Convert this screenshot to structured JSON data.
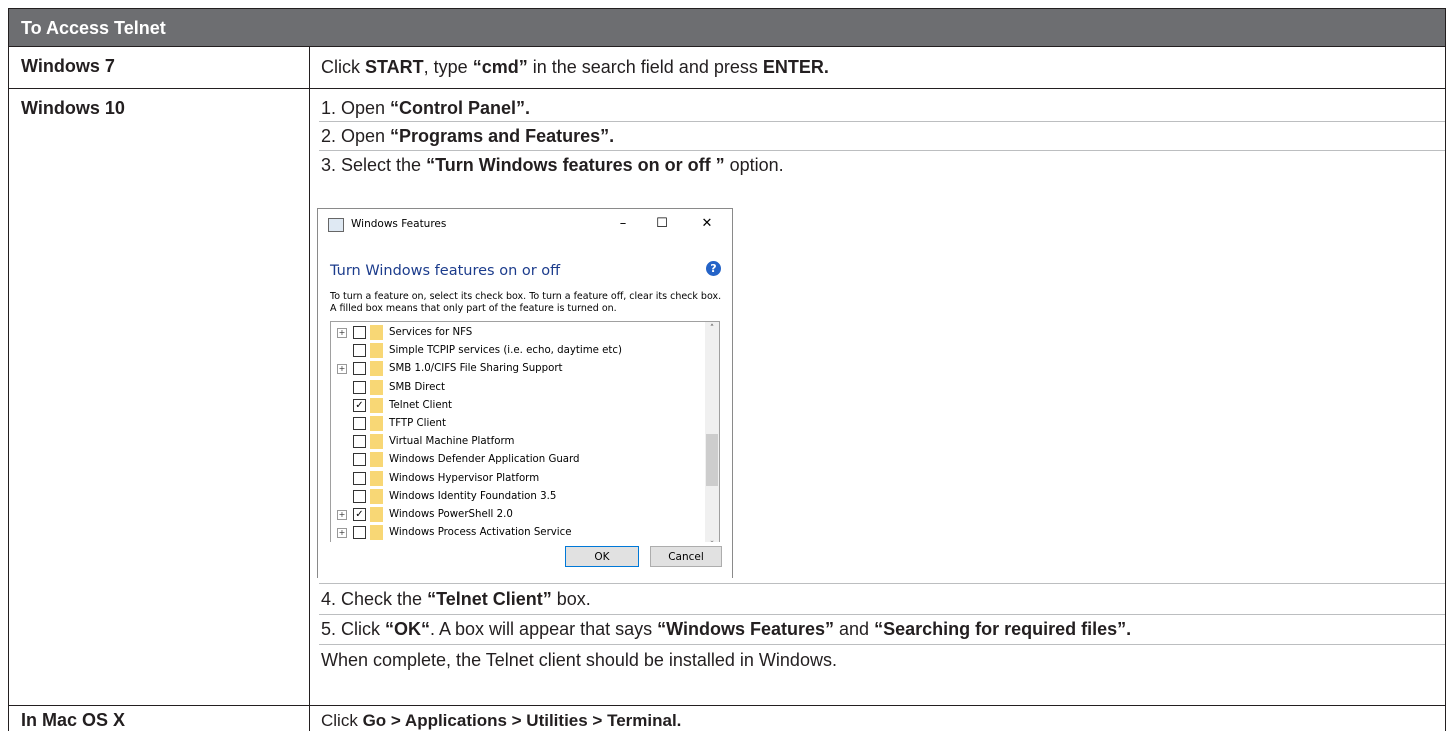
{
  "header": {
    "title": "To Access Telnet"
  },
  "rows": {
    "win7": {
      "label": "Windows 7",
      "parts": [
        "Click ",
        "START",
        ", type ",
        "“cmd”",
        " in the search field and press ",
        "ENTER."
      ]
    },
    "win10": {
      "label": "Windows 10",
      "step1": [
        "1. Open ",
        "“Control Panel”."
      ],
      "step2": [
        "2. Open ",
        "“Programs and Features”."
      ],
      "step3": [
        "3. Select the ",
        "“Turn Windows features on or off ”",
        " option."
      ],
      "step4": [
        "4. Check the ",
        "“Telnet Client”",
        " box."
      ],
      "step5": [
        "5. Click ",
        "“OK“",
        ". A box will appear that says ",
        "“Windows Features”",
        " and ",
        "“Searching for required files”."
      ],
      "step5b": "When complete, the Telnet client should be installed in Windows."
    },
    "mac": {
      "label": "In Mac OS X",
      "parts": [
        "Click ",
        "Go > Applications > Utilities > Terminal."
      ]
    }
  },
  "dialog": {
    "title": "Windows Features",
    "min": "–",
    "max": "☐",
    "close": "✕",
    "heading": "Turn Windows features on or off",
    "help": "?",
    "description": "To turn a feature on, select its check box. To turn a feature off, clear its check box. A filled box means that only part of the feature is turned on.",
    "ok": "OK",
    "cancel": "Cancel",
    "features": [
      {
        "name": "Services for NFS",
        "expand": true,
        "checked": false
      },
      {
        "name": "Simple TCPIP services (i.e. echo, daytime etc)",
        "expand": false,
        "checked": false
      },
      {
        "name": "SMB 1.0/CIFS File Sharing Support",
        "expand": true,
        "checked": false
      },
      {
        "name": "SMB Direct",
        "expand": false,
        "checked": false
      },
      {
        "name": "Telnet Client",
        "expand": false,
        "checked": true
      },
      {
        "name": "TFTP Client",
        "expand": false,
        "checked": false
      },
      {
        "name": "Virtual Machine Platform",
        "expand": false,
        "checked": false
      },
      {
        "name": "Windows Defender Application Guard",
        "expand": false,
        "checked": false
      },
      {
        "name": "Windows Hypervisor Platform",
        "expand": false,
        "checked": false
      },
      {
        "name": "Windows Identity Foundation 3.5",
        "expand": false,
        "checked": false
      },
      {
        "name": "Windows PowerShell 2.0",
        "expand": true,
        "checked": true
      },
      {
        "name": "Windows Process Activation Service",
        "expand": true,
        "checked": false
      }
    ]
  },
  "colors": {
    "header_bg": "#6d6e71",
    "folder": "#f8d775",
    "accent": "#1c3c8c"
  }
}
